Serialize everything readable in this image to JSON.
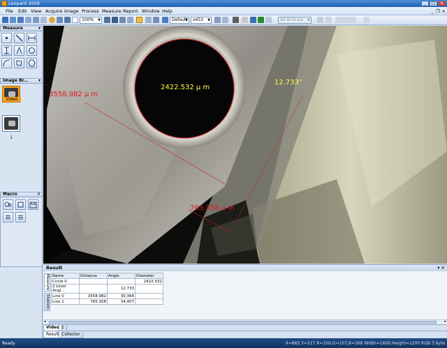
{
  "window": {
    "title": "Leopard 2009"
  },
  "menu": [
    "File",
    "Edit",
    "View",
    "Acquire",
    "Image",
    "Process",
    "Measure",
    "Report",
    "Window",
    "Help"
  ],
  "toolbar": {
    "zoom": "100%",
    "profile": "Default",
    "objective": "x453",
    "disabled_select": "All Al Scale"
  },
  "panels": {
    "measure": {
      "title": "Measure"
    },
    "image_browser": {
      "title": "Image Br...",
      "thumbs": [
        "Video",
        "1"
      ]
    },
    "macro": {
      "title": "Macro"
    }
  },
  "measurements": {
    "diameter": "2422.532 µ m",
    "angle": "12.733°",
    "distance0": "3558.982 µ m",
    "distance1": "765.358 µ m"
  },
  "result": {
    "title": "Result",
    "side_tabs": [
      "Measure",
      "Statistic"
    ],
    "columns": [
      "Name",
      "Distance",
      "Angle",
      "Diameter"
    ],
    "rows": [
      [
        "Circle 0",
        "",
        "",
        "2422.532"
      ],
      [
        "2 Lines Angl...",
        "",
        "12.733",
        ""
      ],
      [
        "Line 0",
        "3558.982",
        "30.366",
        ""
      ],
      [
        "Line 1",
        "765.358",
        "34.407",
        ""
      ]
    ]
  },
  "doc_tabs": [
    "Video",
    "1"
  ],
  "bottom_tabs": [
    "Result",
    "Collector"
  ],
  "status": {
    "left": "Ready",
    "right": "X=865,Y=217   R=100,G=107,B=168   Width=1600,Height=1200   RGB 3 byte"
  },
  "colors": {
    "circle": "#d02020",
    "label_yellow": "#ffff40",
    "label_red": "#e01818",
    "accent": "#1f5fb0"
  }
}
